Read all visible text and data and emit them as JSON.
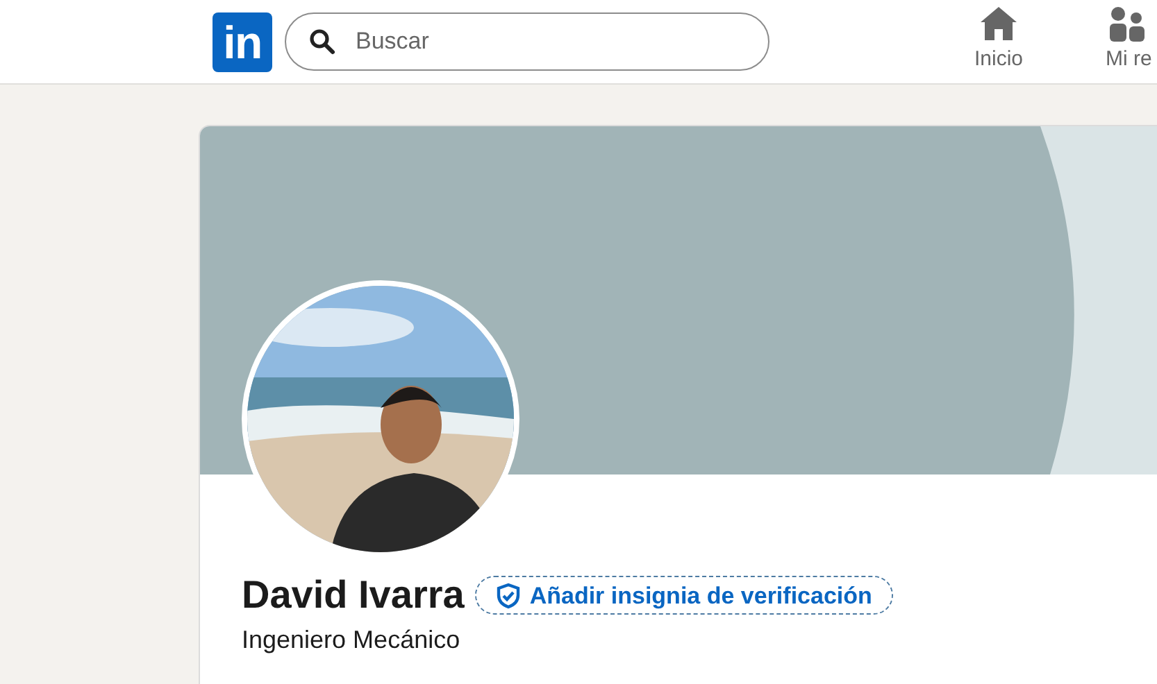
{
  "header": {
    "logo": "in",
    "search": {
      "placeholder": "Buscar"
    },
    "nav": [
      {
        "kind": "home",
        "label": "Inicio"
      },
      {
        "kind": "network",
        "label": "Mi re"
      }
    ]
  },
  "profile": {
    "name": "David Ivarra",
    "badge": "Añadir insignia de verificación",
    "headline": "Ingeniero Mecánico"
  }
}
